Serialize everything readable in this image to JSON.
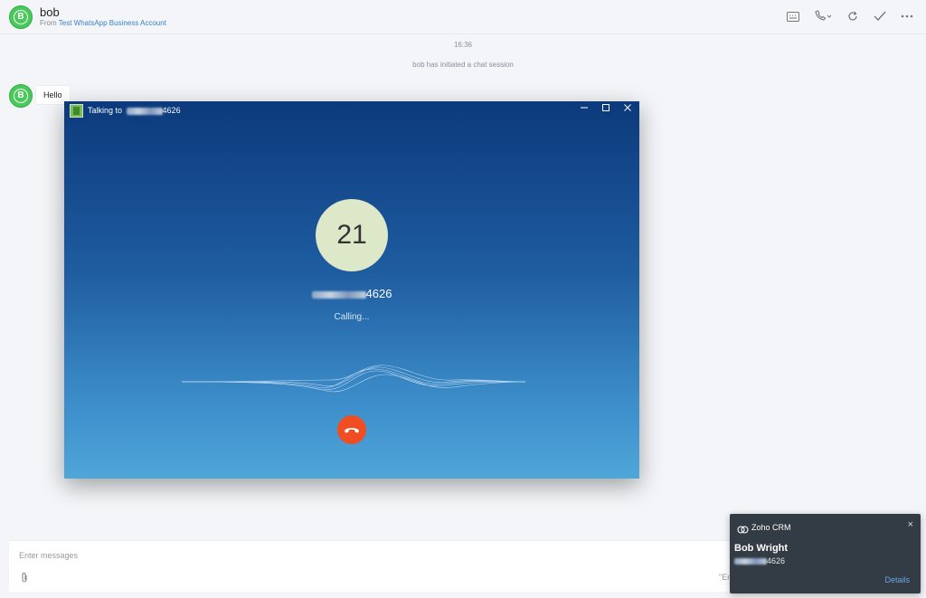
{
  "header": {
    "contact_name": "bob",
    "from_label": "From",
    "account_name": "Test WhatsApp Business Account",
    "avatar_letter": "B",
    "icons": [
      "keyboard-icon",
      "phone-icon",
      "chevron-down-icon",
      "refresh-icon",
      "check-icon",
      "more-icon"
    ]
  },
  "chat": {
    "timestamp": "16:36",
    "system_message": "bob has initiated a chat session",
    "messages": [
      {
        "text": "Hello"
      }
    ]
  },
  "call_window": {
    "title_prefix": "Talking to",
    "number_suffix": "4626",
    "caller_initials": "21",
    "status": "Calling...",
    "accent": "#f04d22"
  },
  "composer": {
    "placeholder": "Enter messages",
    "hint": "\"En"
  },
  "toast": {
    "app_name": "Zoho CRM",
    "contact_name": "Bob Wright",
    "phone_suffix": "4626",
    "details_label": "Details",
    "close_label": "×"
  }
}
